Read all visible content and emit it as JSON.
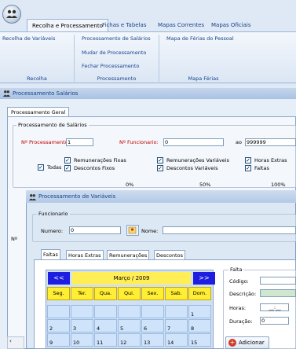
{
  "ribbon": {
    "tabs": [
      {
        "label": "Recolha e Processamento"
      },
      {
        "label": "Fichas e Tabelas"
      },
      {
        "label": "Mapas Correntes"
      },
      {
        "label": "Mapas Oficiais"
      }
    ],
    "groups": {
      "recolha": {
        "items": [
          "Recolha de Variáveis"
        ],
        "label": "Recolha"
      },
      "processamento": {
        "items": [
          "Processamento de Salários",
          "Mudar de Processamento",
          "Fechar Processamento"
        ],
        "label": "Processamento"
      },
      "mapa_ferias": {
        "items": [
          "Mapa de Férias do Pessoal"
        ],
        "label": "Mapa Férias"
      }
    }
  },
  "outer_window": {
    "title": "Processamento Salários",
    "tab": "Processamento Geral",
    "group_title": "Processamento de Salários",
    "n_processamento_label": "Nº Processamento:",
    "n_processamento_value": "1",
    "n_funcionario_label": "Nº Funcionario:",
    "n_funcionario_value": "0",
    "ao_label": "ao",
    "ao_value": "999999",
    "todas_label": "Todas",
    "checkboxes": [
      "Remunerações Fixas",
      "Descontos Fixos",
      "Remunerações Variáveis",
      "Descontos Variáveis",
      "Horas Extras",
      "Faltas"
    ],
    "progress_labels": [
      "0%",
      "50%",
      "100%"
    ],
    "progress": 0,
    "side_fragment": "Nº"
  },
  "inner_window": {
    "title": "Processamento de Variáveis",
    "funcionario_group": "Funcionario",
    "numero_label": "Numero:",
    "numero_value": "0",
    "nome_label": "Nome:",
    "nome_value": "",
    "tabs": [
      "Faltas",
      "Horas Extras",
      "Remunerações",
      "Descontos"
    ],
    "calendar": {
      "prev": "<<",
      "next": ">>",
      "month": "Março / 2009",
      "days": [
        "Seg.",
        "Ter.",
        "Qua.",
        "Qui.",
        "Sex.",
        "Sab.",
        "Dom."
      ],
      "row1": [
        "",
        "",
        "",
        "",
        "",
        "",
        "1"
      ],
      "row2": [
        "2",
        "3",
        "4",
        "5",
        "6",
        "7",
        "8"
      ],
      "row3": [
        "9",
        "10",
        "11",
        "12",
        "13",
        "14",
        "15"
      ]
    },
    "falta": {
      "group_title": "Falta",
      "codigo_label": "Código:",
      "codigo_value": "",
      "descricao_label": "Descrição:",
      "descricao_value": "",
      "horas_label": "Horas:",
      "horas_value": "__:__",
      "duracao_label": "Duração:",
      "duracao_value": "0"
    },
    "add_button": "Adicionar"
  },
  "colors": {
    "accent": "#15428b",
    "required_label": "#c00000",
    "calendar_header": "#ffee33",
    "calendar_nav": "#1e1ee0"
  }
}
